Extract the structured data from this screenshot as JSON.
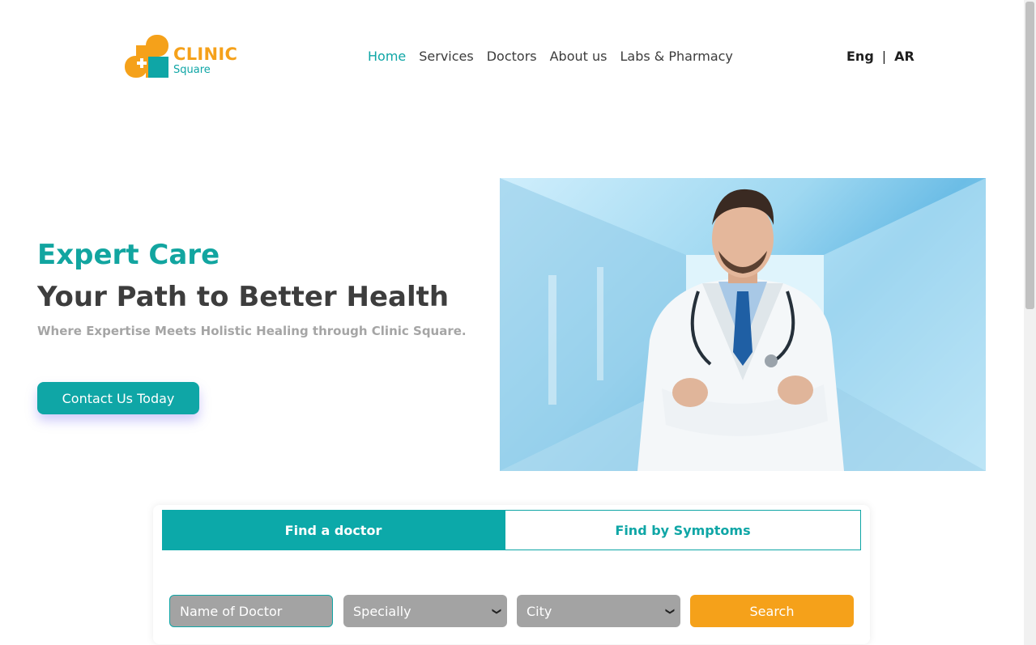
{
  "brand": {
    "name_main": "CLINIC",
    "name_sub": "Square",
    "colors": {
      "teal": "#0fa6a6",
      "orange": "#f5a11a"
    }
  },
  "nav": {
    "items": [
      {
        "label": "Home",
        "active": true
      },
      {
        "label": "Services",
        "active": false
      },
      {
        "label": "Doctors",
        "active": false
      },
      {
        "label": "About us",
        "active": false
      },
      {
        "label": "Labs & Pharmacy",
        "active": false
      }
    ]
  },
  "lang": {
    "eng": "Eng",
    "separator": "|",
    "ar": "AR"
  },
  "hero": {
    "title": "Expert Care",
    "heading": "Your Path to Better Health",
    "subtitle": "Where Expertise Meets Holistic Healing through Clinic Square.",
    "cta_label": "Contact Us Today",
    "image_subject": "doctor in white coat with stethoscope in hospital corridor"
  },
  "search": {
    "tabs": [
      {
        "label": "Find a doctor",
        "active": true
      },
      {
        "label": "Find by Symptoms",
        "active": false
      }
    ],
    "name_placeholder": "Name of Doctor",
    "specialty_label": "Specially",
    "city_label": "City",
    "search_label": "Search"
  }
}
